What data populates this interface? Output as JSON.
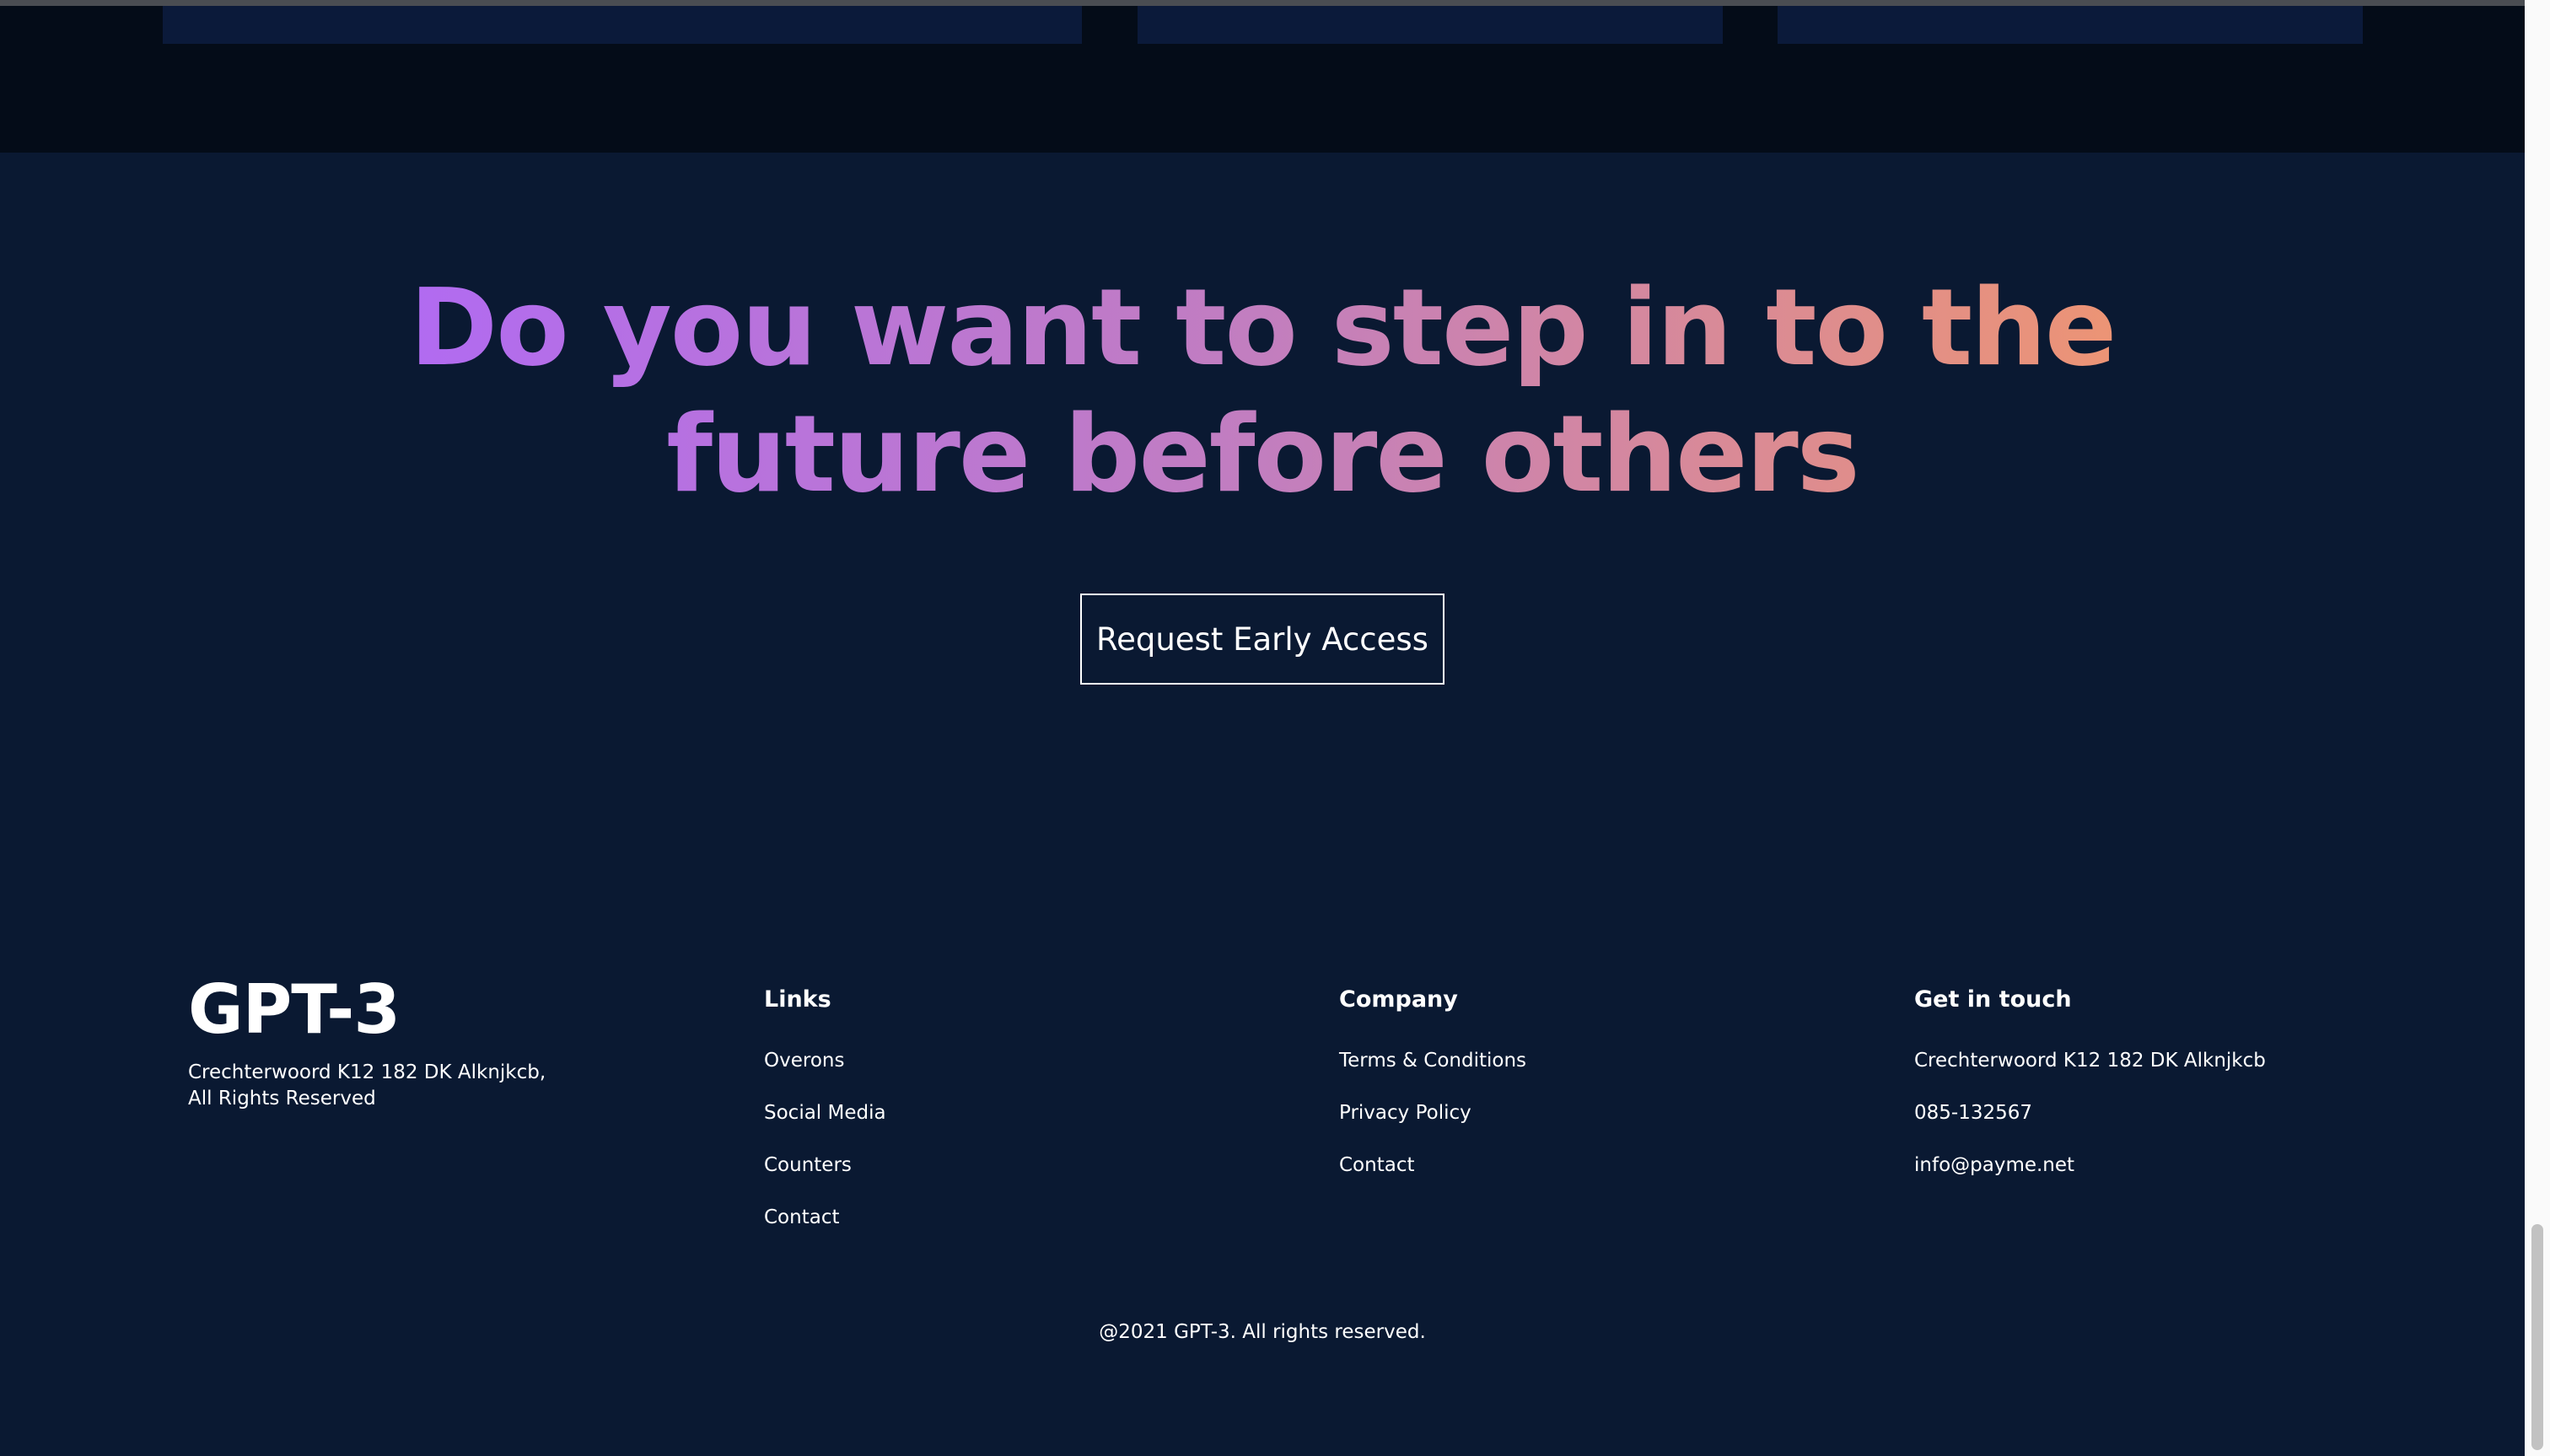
{
  "cta_section": {
    "headline": "Do you want to step in to the future before others",
    "button_label": "Request Early Access"
  },
  "footer": {
    "logo_text": "GPT-3",
    "address_line1": "Crechterwoord K12 182 DK Alknjkcb,",
    "address_line2": "All Rights Reserved",
    "columns": [
      {
        "title": "Links",
        "items": [
          "Overons",
          "Social Media",
          "Counters",
          "Contact"
        ]
      },
      {
        "title": "Company",
        "items": [
          "Terms & Conditions",
          "Privacy Policy",
          "Contact"
        ]
      },
      {
        "title": "Get in touch",
        "items": [
          "Crechterwoord K12 182 DK Alknjkcb",
          "085-132567",
          "info@payme.net"
        ]
      }
    ],
    "copyright": "@2021 GPT-3. All rights reserved."
  },
  "colors": {
    "background": "#0A1932",
    "top_band": "#040C18",
    "gradient_start": "#AE67FA",
    "gradient_end": "#F49867"
  }
}
